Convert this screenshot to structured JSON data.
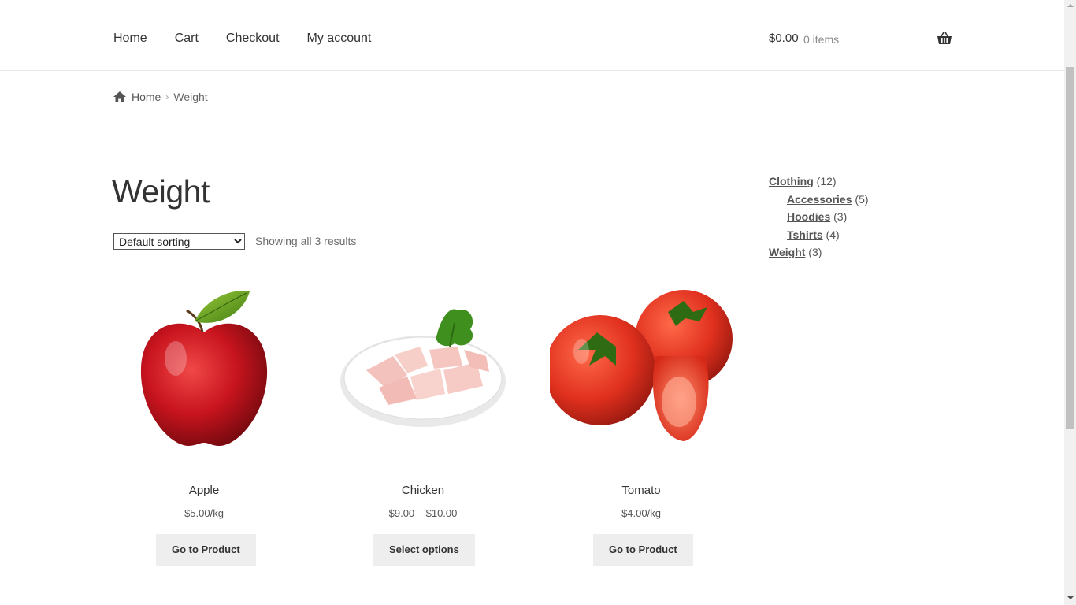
{
  "header": {
    "nav": [
      "Home",
      "Cart",
      "Checkout",
      "My account"
    ],
    "cart_total": "$0.00",
    "cart_count": "0 items",
    "cart_icon": "basket-icon"
  },
  "breadcrumb": {
    "home_icon": "home-icon",
    "home": "Home",
    "separator": "›",
    "current": "Weight"
  },
  "page": {
    "title": "Weight",
    "sorting_selected": "Default sorting",
    "result_count": "Showing all 3 results"
  },
  "sidebar": {
    "categories": [
      {
        "name": "Clothing",
        "count": "(12)",
        "level": 0
      },
      {
        "name": "Accessories",
        "count": "(5)",
        "level": 1
      },
      {
        "name": "Hoodies",
        "count": "(3)",
        "level": 1
      },
      {
        "name": "Tshirts",
        "count": "(4)",
        "level": 1
      },
      {
        "name": "Weight",
        "count": "(3)",
        "level": 0
      }
    ]
  },
  "products": [
    {
      "name": "Apple",
      "price": "$5.00/kg",
      "button": "Go to Product",
      "image": "apple-image"
    },
    {
      "name": "Chicken",
      "price": "$9.00 – $10.00",
      "button": "Select options",
      "image": "chicken-image"
    },
    {
      "name": "Tomato",
      "price": "$4.00/kg",
      "button": "Go to Product",
      "image": "tomato-image"
    }
  ],
  "colors": {
    "text": "#333333",
    "button_bg": "#eeeeee",
    "apple_red": "#c8141e",
    "tomato_red": "#e0301e"
  }
}
